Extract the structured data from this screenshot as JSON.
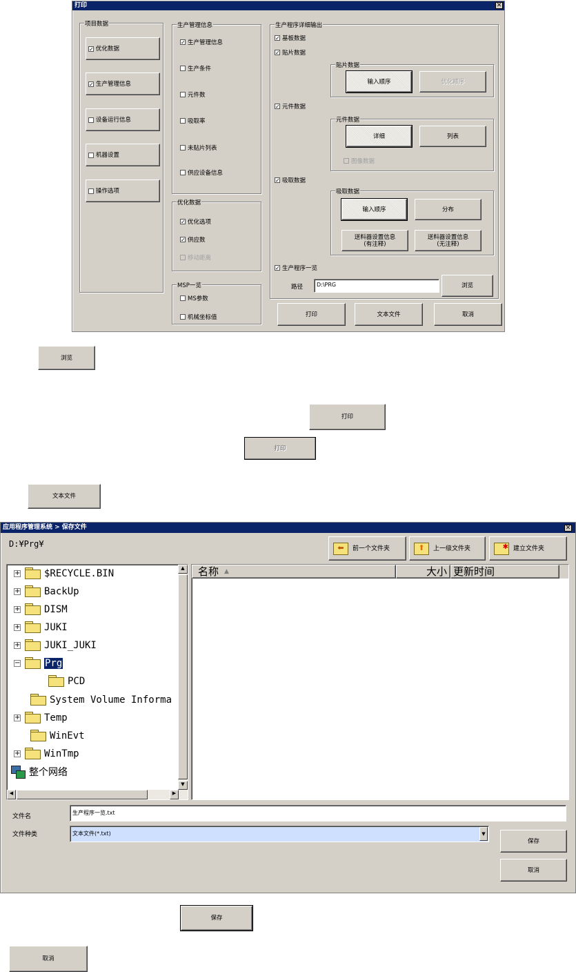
{
  "print_dialog": {
    "title": "打印",
    "close": "✕",
    "group_items": "项目数据",
    "items": [
      {
        "label": "优化数据",
        "checked": true
      },
      {
        "label": "生产管理信息",
        "checked": true
      },
      {
        "label": "设备运行信息",
        "checked": false
      },
      {
        "label": "机器设置",
        "checked": false
      },
      {
        "label": "操作选项",
        "checked": false
      }
    ],
    "group_prod_mgmt": "生产管理信息",
    "prod_mgmt": [
      {
        "label": "生产管理信息",
        "checked": true
      },
      {
        "label": "生产条件",
        "checked": false
      },
      {
        "label": "元件数",
        "checked": false
      },
      {
        "label": "吸取率",
        "checked": false
      },
      {
        "label": "未贴片列表",
        "checked": false
      },
      {
        "label": "供应设备信息",
        "checked": false
      }
    ],
    "group_optimize": "优化数据",
    "optimize": [
      {
        "label": "优化选项",
        "checked": true
      },
      {
        "label": "供应数",
        "checked": true
      },
      {
        "label": "移动距离",
        "checked": false,
        "disabled": true
      }
    ],
    "group_msp": "MSP一览",
    "msp": [
      {
        "label": "MS参数",
        "checked": false
      },
      {
        "label": "机械坐标值",
        "checked": false
      }
    ],
    "group_detail": "生产程序详细输出",
    "detail": {
      "basic": {
        "label": "基板数据",
        "checked": true
      },
      "mount": {
        "label": "贴片数据",
        "checked": true
      },
      "mount_group": "贴片数据",
      "mount_btn_input": "输入顺序",
      "mount_btn_opt": "优化顺序",
      "component": {
        "label": "元件数据",
        "checked": true
      },
      "component_group": "元件数据",
      "comp_btn_detail": "详细",
      "comp_btn_list": "列表",
      "image_data": {
        "label": "图像数据",
        "checked": false
      },
      "pickup": {
        "label": "吸取数据",
        "checked": true
      },
      "pickup_group": "吸取数据",
      "pick_btn_input": "输入顺序",
      "pick_btn_dist": "分布",
      "pick_btn_feeder_comment": "送料器设置信息\n(有注释)",
      "pick_btn_feeder_nocomment": "送料器设置信息\n(无注释)",
      "prog_list": {
        "label": "生产程序一览",
        "checked": true
      },
      "path_label": "路径",
      "path_value": "D:\\PRG",
      "browse": "浏览"
    },
    "btn_print": "打印",
    "btn_textfile": "文本文件",
    "btn_cancel": "取消"
  },
  "standalone": {
    "browse": "浏览",
    "print": "打印",
    "print_gray": "打印",
    "textfile": "文本文件",
    "save": "保存",
    "cancel": "取消"
  },
  "save_dialog": {
    "title": "应用程序管理系统 > 保存文件",
    "close": "✕",
    "current_path": "D:¥Prg¥",
    "btn_prev_folder": "前一个文件夹",
    "btn_up_folder": "上一级文件夹",
    "btn_new_folder": "建立文件夹",
    "tree": [
      {
        "name": "$RECYCLE.BIN",
        "expander": "+"
      },
      {
        "name": "BackUp",
        "expander": "+"
      },
      {
        "name": "DISM",
        "expander": "+"
      },
      {
        "name": "JUKI",
        "expander": "+"
      },
      {
        "name": "JUKI_JUKI",
        "expander": "+"
      },
      {
        "name": "Prg",
        "expander": "−",
        "selected": true
      },
      {
        "name": "PCD",
        "expander": ""
      },
      {
        "name": "System Volume Informa",
        "expander": ""
      },
      {
        "name": "Temp",
        "expander": "+"
      },
      {
        "name": "WinEvt",
        "expander": ""
      },
      {
        "name": "WinTmp",
        "expander": "+"
      },
      {
        "name": "整个网络",
        "expander": ""
      }
    ],
    "col_name": "名称",
    "col_size": "大小",
    "col_updated": "更新时间",
    "filename_label": "文件名",
    "filename_value": "生产程序一览.txt",
    "filetype_label": "文件种类",
    "filetype_value": "文本文件(*.txt)",
    "btn_save": "保存",
    "btn_cancel": "取消"
  }
}
